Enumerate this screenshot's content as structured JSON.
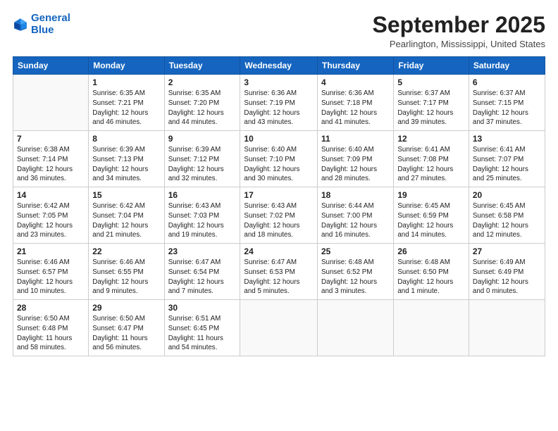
{
  "header": {
    "logo_line1": "General",
    "logo_line2": "Blue",
    "month_title": "September 2025",
    "location": "Pearlington, Mississippi, United States"
  },
  "days_of_week": [
    "Sunday",
    "Monday",
    "Tuesday",
    "Wednesday",
    "Thursday",
    "Friday",
    "Saturday"
  ],
  "weeks": [
    [
      {
        "day": "",
        "info": ""
      },
      {
        "day": "1",
        "info": "Sunrise: 6:35 AM\nSunset: 7:21 PM\nDaylight: 12 hours\nand 46 minutes."
      },
      {
        "day": "2",
        "info": "Sunrise: 6:35 AM\nSunset: 7:20 PM\nDaylight: 12 hours\nand 44 minutes."
      },
      {
        "day": "3",
        "info": "Sunrise: 6:36 AM\nSunset: 7:19 PM\nDaylight: 12 hours\nand 43 minutes."
      },
      {
        "day": "4",
        "info": "Sunrise: 6:36 AM\nSunset: 7:18 PM\nDaylight: 12 hours\nand 41 minutes."
      },
      {
        "day": "5",
        "info": "Sunrise: 6:37 AM\nSunset: 7:17 PM\nDaylight: 12 hours\nand 39 minutes."
      },
      {
        "day": "6",
        "info": "Sunrise: 6:37 AM\nSunset: 7:15 PM\nDaylight: 12 hours\nand 37 minutes."
      }
    ],
    [
      {
        "day": "7",
        "info": "Sunrise: 6:38 AM\nSunset: 7:14 PM\nDaylight: 12 hours\nand 36 minutes."
      },
      {
        "day": "8",
        "info": "Sunrise: 6:39 AM\nSunset: 7:13 PM\nDaylight: 12 hours\nand 34 minutes."
      },
      {
        "day": "9",
        "info": "Sunrise: 6:39 AM\nSunset: 7:12 PM\nDaylight: 12 hours\nand 32 minutes."
      },
      {
        "day": "10",
        "info": "Sunrise: 6:40 AM\nSunset: 7:10 PM\nDaylight: 12 hours\nand 30 minutes."
      },
      {
        "day": "11",
        "info": "Sunrise: 6:40 AM\nSunset: 7:09 PM\nDaylight: 12 hours\nand 28 minutes."
      },
      {
        "day": "12",
        "info": "Sunrise: 6:41 AM\nSunset: 7:08 PM\nDaylight: 12 hours\nand 27 minutes."
      },
      {
        "day": "13",
        "info": "Sunrise: 6:41 AM\nSunset: 7:07 PM\nDaylight: 12 hours\nand 25 minutes."
      }
    ],
    [
      {
        "day": "14",
        "info": "Sunrise: 6:42 AM\nSunset: 7:05 PM\nDaylight: 12 hours\nand 23 minutes."
      },
      {
        "day": "15",
        "info": "Sunrise: 6:42 AM\nSunset: 7:04 PM\nDaylight: 12 hours\nand 21 minutes."
      },
      {
        "day": "16",
        "info": "Sunrise: 6:43 AM\nSunset: 7:03 PM\nDaylight: 12 hours\nand 19 minutes."
      },
      {
        "day": "17",
        "info": "Sunrise: 6:43 AM\nSunset: 7:02 PM\nDaylight: 12 hours\nand 18 minutes."
      },
      {
        "day": "18",
        "info": "Sunrise: 6:44 AM\nSunset: 7:00 PM\nDaylight: 12 hours\nand 16 minutes."
      },
      {
        "day": "19",
        "info": "Sunrise: 6:45 AM\nSunset: 6:59 PM\nDaylight: 12 hours\nand 14 minutes."
      },
      {
        "day": "20",
        "info": "Sunrise: 6:45 AM\nSunset: 6:58 PM\nDaylight: 12 hours\nand 12 minutes."
      }
    ],
    [
      {
        "day": "21",
        "info": "Sunrise: 6:46 AM\nSunset: 6:57 PM\nDaylight: 12 hours\nand 10 minutes."
      },
      {
        "day": "22",
        "info": "Sunrise: 6:46 AM\nSunset: 6:55 PM\nDaylight: 12 hours\nand 9 minutes."
      },
      {
        "day": "23",
        "info": "Sunrise: 6:47 AM\nSunset: 6:54 PM\nDaylight: 12 hours\nand 7 minutes."
      },
      {
        "day": "24",
        "info": "Sunrise: 6:47 AM\nSunset: 6:53 PM\nDaylight: 12 hours\nand 5 minutes."
      },
      {
        "day": "25",
        "info": "Sunrise: 6:48 AM\nSunset: 6:52 PM\nDaylight: 12 hours\nand 3 minutes."
      },
      {
        "day": "26",
        "info": "Sunrise: 6:48 AM\nSunset: 6:50 PM\nDaylight: 12 hours\nand 1 minute."
      },
      {
        "day": "27",
        "info": "Sunrise: 6:49 AM\nSunset: 6:49 PM\nDaylight: 12 hours\nand 0 minutes."
      }
    ],
    [
      {
        "day": "28",
        "info": "Sunrise: 6:50 AM\nSunset: 6:48 PM\nDaylight: 11 hours\nand 58 minutes."
      },
      {
        "day": "29",
        "info": "Sunrise: 6:50 AM\nSunset: 6:47 PM\nDaylight: 11 hours\nand 56 minutes."
      },
      {
        "day": "30",
        "info": "Sunrise: 6:51 AM\nSunset: 6:45 PM\nDaylight: 11 hours\nand 54 minutes."
      },
      {
        "day": "",
        "info": ""
      },
      {
        "day": "",
        "info": ""
      },
      {
        "day": "",
        "info": ""
      },
      {
        "day": "",
        "info": ""
      }
    ]
  ]
}
